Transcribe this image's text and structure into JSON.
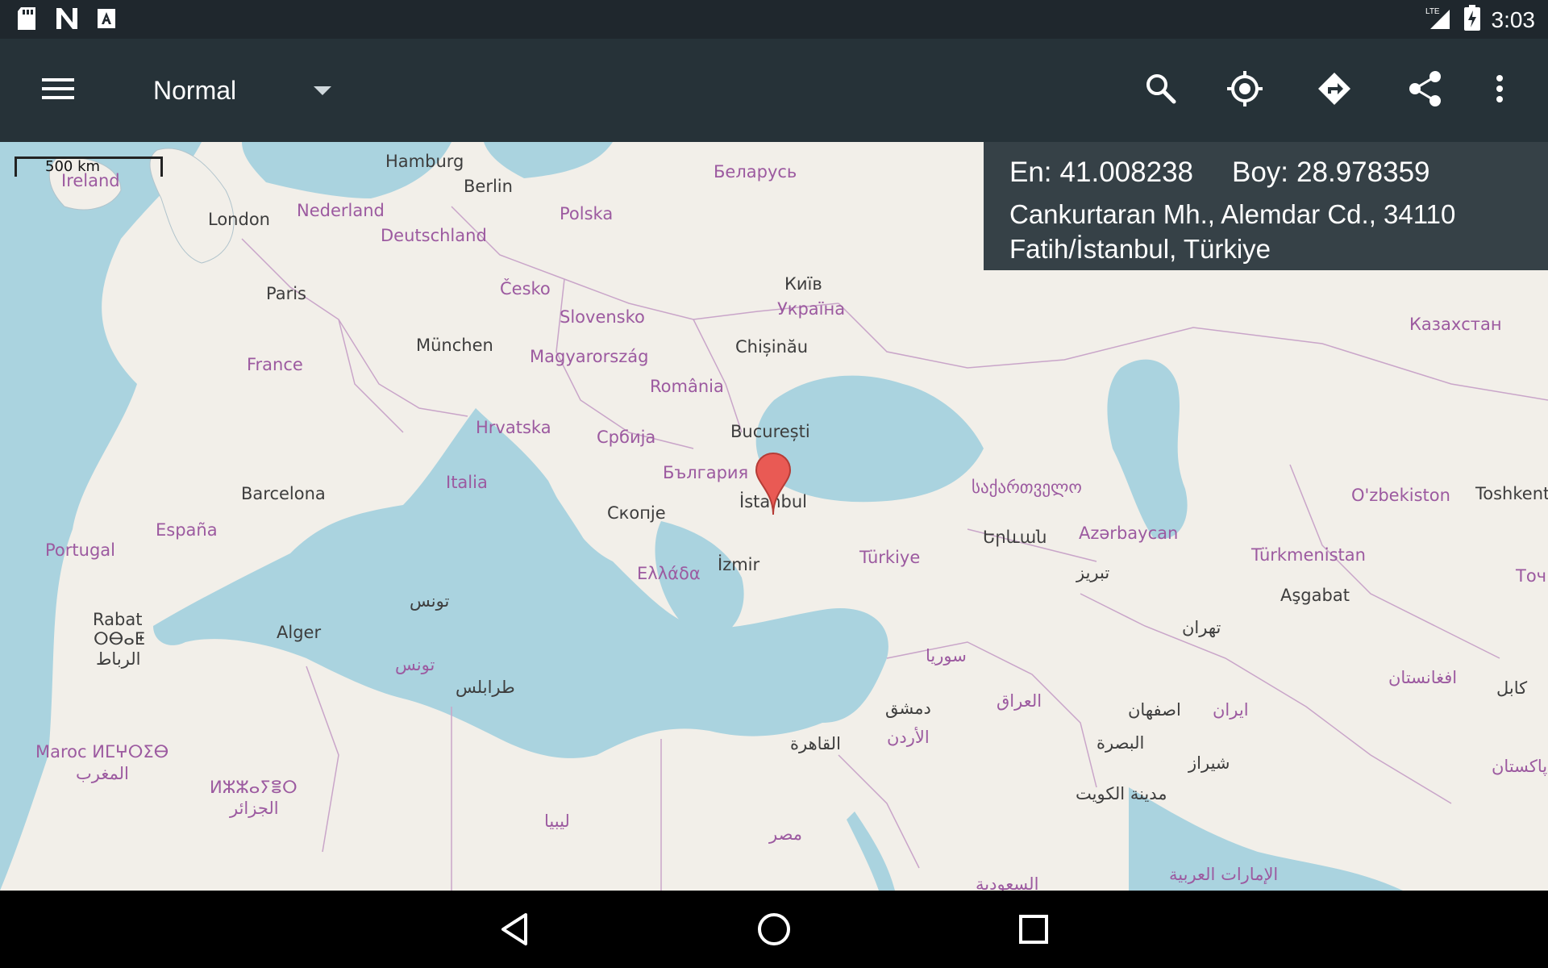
{
  "status_bar": {
    "time": "3:03",
    "network": "LTE",
    "icons": [
      "sd-card-icon",
      "n-app-icon",
      "a-app-icon",
      "signal-icon",
      "battery-charging-icon"
    ]
  },
  "toolbar": {
    "map_type": "Normal",
    "actions": [
      "menu-icon",
      "search-icon",
      "my-location-icon",
      "directions-icon",
      "share-icon",
      "overflow-icon"
    ]
  },
  "info": {
    "lat_label": "En:",
    "lat_value": "41.008238",
    "lon_label": "Boy:",
    "lon_value": "28.978359",
    "address_line1": "Cankurtaran Mh., Alemdar Cd., 34110",
    "address_line2": "Fatih/İstanbul, Türkiye"
  },
  "map": {
    "scale_label": "500 km",
    "labels": {
      "hamburg": "Hamburg",
      "belarus": "Беларусь",
      "ireland": "Ireland",
      "london": "London",
      "nederland": "Nederland",
      "berlin": "Berlin",
      "polska": "Polska",
      "deutschland": "Deutschland",
      "kyiv": "Київ",
      "cesko": "Česko",
      "paris": "Paris",
      "ukraina": "Україна",
      "kazakhstan": "Казахстан",
      "slovensko": "Slovensko",
      "munchen": "München",
      "chisinau": "Chișinău",
      "magyarorszag": "Magyarország",
      "france": "France",
      "romania": "România",
      "hrvatska": "Hrvatska",
      "srbija": "Србија",
      "bucuresti": "București",
      "bulgaria": "България",
      "italia": "Italia",
      "georgia": "საქართველო",
      "oz": "O'zbekiston",
      "toshkent": "Toshkent",
      "barcelona": "Barcelona",
      "istanbul": "İstanbul",
      "skopje": "Скопје",
      "espana": "España",
      "azerbaycan": "Azərbaycan",
      "yerevan": "Երևան",
      "portugal": "Portugal",
      "turkmenistan": "Türkmenistan",
      "turkiye": "Türkiye",
      "izmir": "İzmir",
      "tochiki": "Точикі",
      "tabriz": "تبریز",
      "ellada": "Ελλάδα",
      "tunis": "تونس",
      "ashgabat": "Aşgabat",
      "rabat": "Rabat",
      "rabat_tifinagh": "ⵔⴱⴰⵟ",
      "alger": "Alger",
      "tehran": "تهران",
      "tunis2": "تونس",
      "rabat_ar": "الرباط",
      "syria": "سوريا",
      "afghanistan": "افغانستان",
      "kabul": "كابل",
      "tarabulus": "طرابلس",
      "dimashq": "دمشق",
      "iraq": "العراق",
      "isfahan": "اصفهان",
      "iran": "ايران",
      "urdun": "الأردن",
      "maroc": "Maroc ⵍⵎⵖⵔⵉⴱ",
      "cairo": "القاهرة",
      "basra": "البصرة",
      "pakistan": "پاکستان",
      "maghrib_ar": "المغرب",
      "shiraz": "شیراز",
      "dzayer": "ⵍⵣⵣⴰⵢⴻⵔ",
      "kuwait": "مدينة الكويت",
      "jazair": "الجزائر",
      "libya": "ليبيا",
      "misr": "مصر",
      "saudi": "السعودية",
      "uae": "الإمارات العربية"
    }
  },
  "nav": [
    "back-icon",
    "home-icon",
    "recents-icon"
  ]
}
